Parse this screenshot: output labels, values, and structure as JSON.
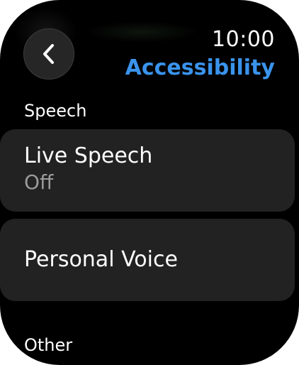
{
  "status": {
    "time": "10:00"
  },
  "header": {
    "title": "Accessibility",
    "back_icon": "chevron-left-icon"
  },
  "sections": [
    {
      "header": "Speech",
      "rows": [
        {
          "title": "Live Speech",
          "value": "Off"
        },
        {
          "title": "Personal Voice"
        }
      ]
    },
    {
      "header": "Other"
    }
  ],
  "colors": {
    "accent": "#3a93ec",
    "background": "#000000",
    "row_background": "#222222",
    "secondary_text": "#9a9a9a"
  }
}
